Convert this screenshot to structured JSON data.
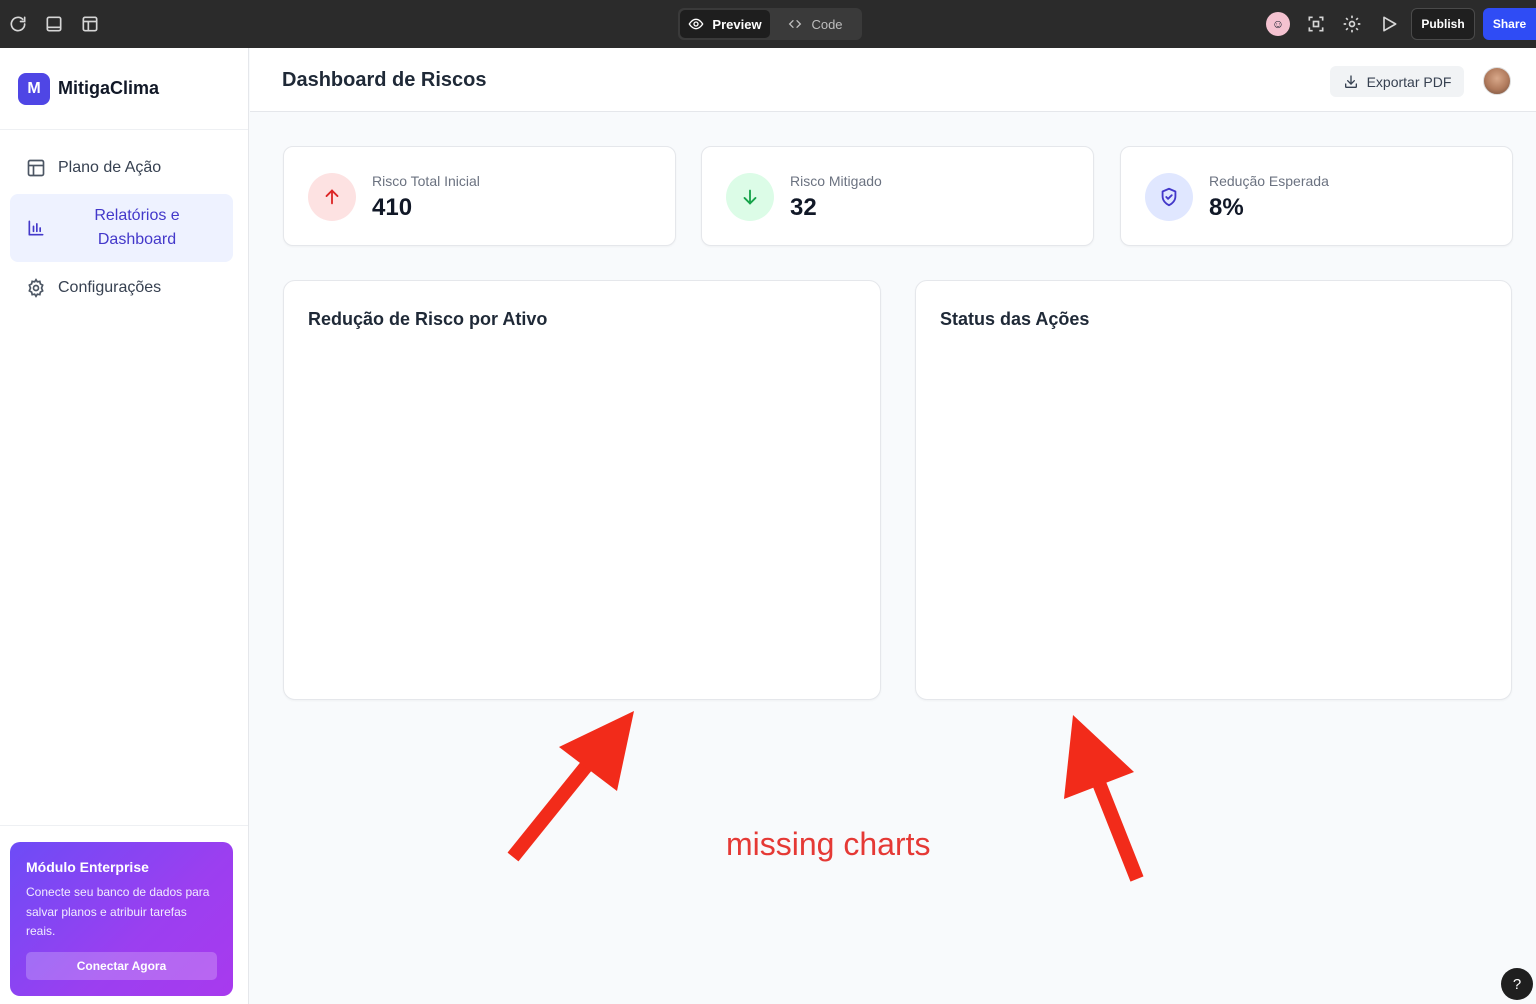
{
  "editor": {
    "modes": [
      {
        "label": "Preview",
        "icon": "eye-icon",
        "active": true
      },
      {
        "label": "Code",
        "icon": "code-icon",
        "active": false
      }
    ],
    "publish_label": "Publish",
    "share_label": "Share",
    "share_color": "#2f4cf5"
  },
  "sidebar": {
    "brand_letter": "M",
    "brand_name": "MitigaClima",
    "brand_color": "#4f46e5",
    "items": [
      {
        "label": "Plano de Ação",
        "icon": "layout-icon",
        "active": false
      },
      {
        "label": "Relatórios e Dashboard",
        "icon": "bar-chart-icon",
        "active": true
      },
      {
        "label": "Configurações",
        "icon": "gear-icon",
        "active": false
      }
    ],
    "promo": {
      "title": "Módulo Enterprise",
      "text": "Conecte seu banco de dados para salvar planos e atribuir tarefas reais.",
      "button": "Conectar Agora"
    }
  },
  "header": {
    "title": "Dashboard de Riscos",
    "export_label": "Exportar PDF"
  },
  "stats": [
    {
      "label": "Risco Total Inicial",
      "value": "410",
      "icon": "arrow-up-icon",
      "color": "#dc2626",
      "bg": "#fde2e2"
    },
    {
      "label": "Risco Mitigado",
      "value": "32",
      "icon": "arrow-down-icon",
      "color": "#16a34a",
      "bg": "#dcfce7"
    },
    {
      "label": "Redução Esperada",
      "value": "8%",
      "icon": "shield-check-icon",
      "color": "#4338ca",
      "bg": "#e0e7ff"
    }
  ],
  "panels": [
    {
      "title": "Redução de Risco por Ativo"
    },
    {
      "title": "Status das Ações"
    }
  ],
  "annotation": {
    "text": "missing charts",
    "color": "#e53935"
  },
  "help_label": "?"
}
